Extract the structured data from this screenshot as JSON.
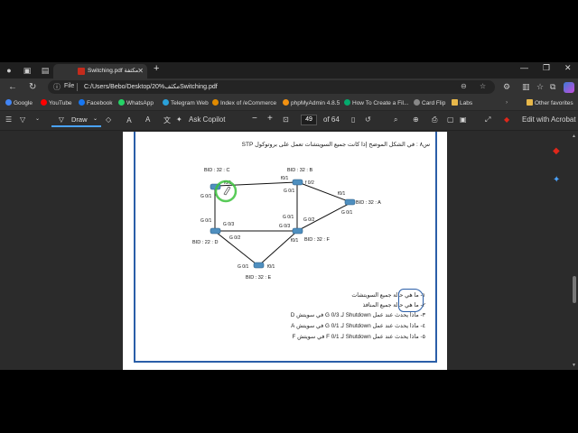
{
  "browser": {
    "tab_title": "Switching.pdf مكثفة",
    "new_tab": "+",
    "address_label": "File",
    "url": "C:/Users/Bebo/Desktop/20%مكثفSwitching.pdf"
  },
  "bookmarks": [
    {
      "label": "Google",
      "color": "#4285f4"
    },
    {
      "label": "YouTube",
      "color": "#ff0000"
    },
    {
      "label": "Facebook",
      "color": "#1877f2"
    },
    {
      "label": "WhatsApp",
      "color": "#25d366"
    },
    {
      "label": "Telegram Web",
      "color": "#2aa1da"
    },
    {
      "label": "Index of /eCommerce",
      "color": "#e08a00"
    },
    {
      "label": "phpMyAdmin 4.8.5",
      "color": "#f29111"
    },
    {
      "label": "How To Create a Fil...",
      "color": "#04aa6d"
    },
    {
      "label": "Card Flip",
      "color": "#888888"
    },
    {
      "label": "Labs",
      "color": "#e8b84a"
    },
    {
      "label": "Other favorites",
      "color": "#e8b84a"
    }
  ],
  "pdf_toolbar": {
    "draw": "Draw",
    "ask_copilot": "Ask Copilot",
    "minus": "−",
    "plus": "+",
    "page_current": "49",
    "page_total": "of 64",
    "edit_acrobat": "Edit with Acrobat"
  },
  "document": {
    "question": "س٨ : في الشكل الموضح إذا كانت جميع السويتشات تعمل على بروتوكول STP",
    "switches": {
      "C": "BID : 32 : C",
      "B": "BID : 32 : B",
      "A": "BID : 32 : A",
      "D": "BID : 22 : D",
      "F": "BID : 32 : F",
      "E": "BID : 32 : E"
    },
    "ports": {
      "c_f01": "f0/1",
      "c_g01": "G 0/1",
      "b_f01": "f0/1",
      "b_f02": "f 0/2",
      "b_g01": "G 0/1",
      "a_f01": "f0/1",
      "a_g01": "G 0/1",
      "d_g01": "G 0/1",
      "d_g03": "G 0/3",
      "d_g02": "G 0/2",
      "f_g01": "G 0/1",
      "f_g03": "G 0/3",
      "f_g02": "G 0/2",
      "f_f01": "f0/1",
      "e_g01": "G 0/1",
      "e_f01": "f0/1"
    },
    "sub_questions": [
      "١- ما هي حالة جميع السويتشات",
      "٢- ما هي حالة جميع المنافذ",
      "٣- ماذا يحدث عند عمل Shutdown لـ G 0/3 في سويتش D",
      "٤- ماذا يحدث عند عمل Shutdown لـ G 0/1 في سويتش A",
      "٥- ماذا يحدث عند عمل Shutdown لـ F 0/1 في سويتش F"
    ]
  },
  "colors": {
    "frame_border": "#2a5ea8",
    "switch_fill": "#4f8fbf",
    "cursor_ring": "#3cc23c",
    "acrobat_red": "#e0271a"
  }
}
